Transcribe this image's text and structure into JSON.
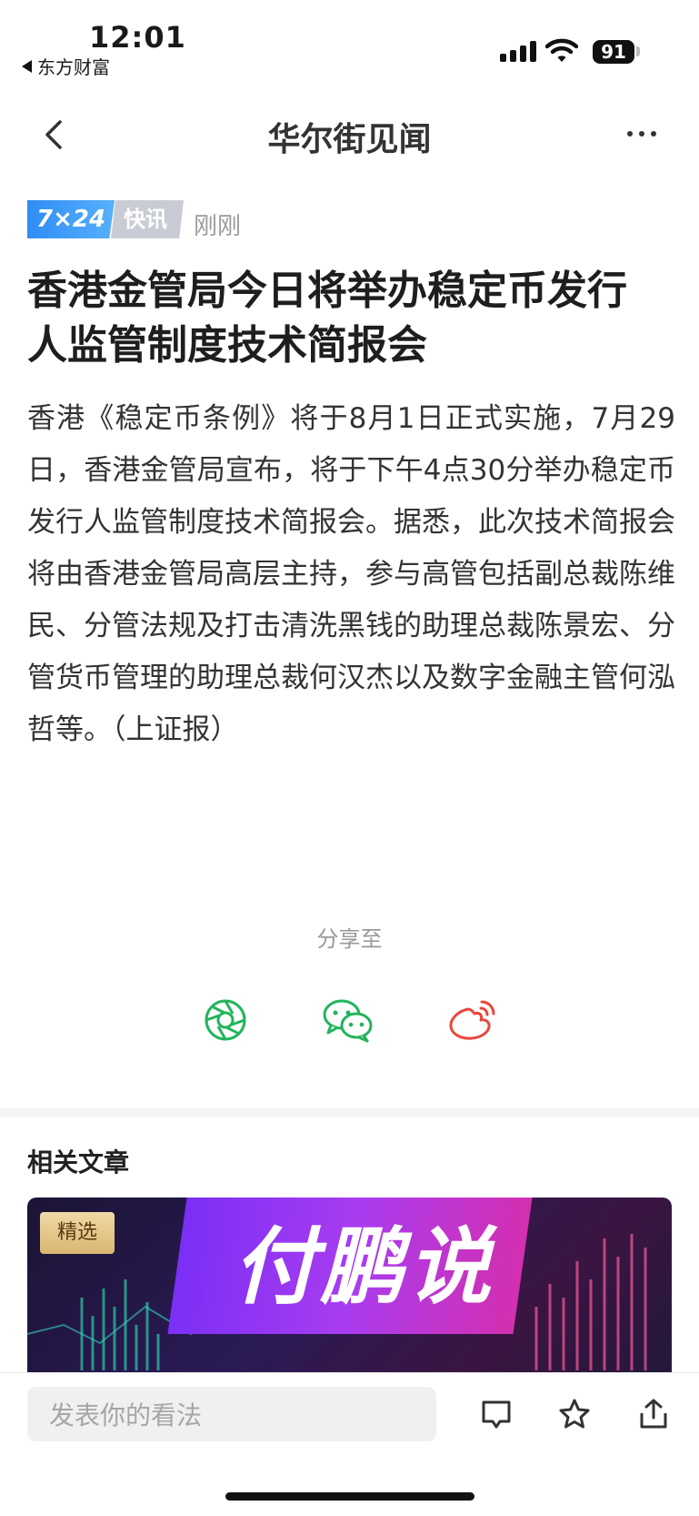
{
  "status_bar": {
    "time": "12:01",
    "back_app": "东方财富",
    "battery": "91"
  },
  "nav": {
    "title": "华尔街见闻"
  },
  "article": {
    "tag_724": "7×24",
    "tag_flash": "快讯",
    "time": "刚刚",
    "headline": "香港金管局今日将举办稳定币发行人监管制度技术简报会",
    "body": "香港《稳定币条例》将于8月1日正式实施，7月29日，香港金管局宣布，将于下午4点30分举办稳定币发行人监管制度技术简报会。据悉，此次技术简报会将由香港金管局高层主持，参与高管包括副总裁陈维民、分管法规及打击清洗黑钱的助理总裁陈景宏、分管货币管理的助理总裁何汉杰以及数字金融主管何泓哲等。（上证报）"
  },
  "share": {
    "label": "分享至",
    "icons": [
      "moments-icon",
      "wechat-icon",
      "weibo-icon"
    ],
    "colors": {
      "moments": "#22b45a",
      "wechat": "#22b45a",
      "weibo": "#e8483c"
    }
  },
  "related": {
    "title": "相关文章",
    "banner_badge": "精选",
    "banner_title": "付鹏说"
  },
  "bottom_bar": {
    "comment_placeholder": "发表你的看法",
    "icons": [
      "comment-icon",
      "star-icon",
      "share-icon"
    ]
  }
}
